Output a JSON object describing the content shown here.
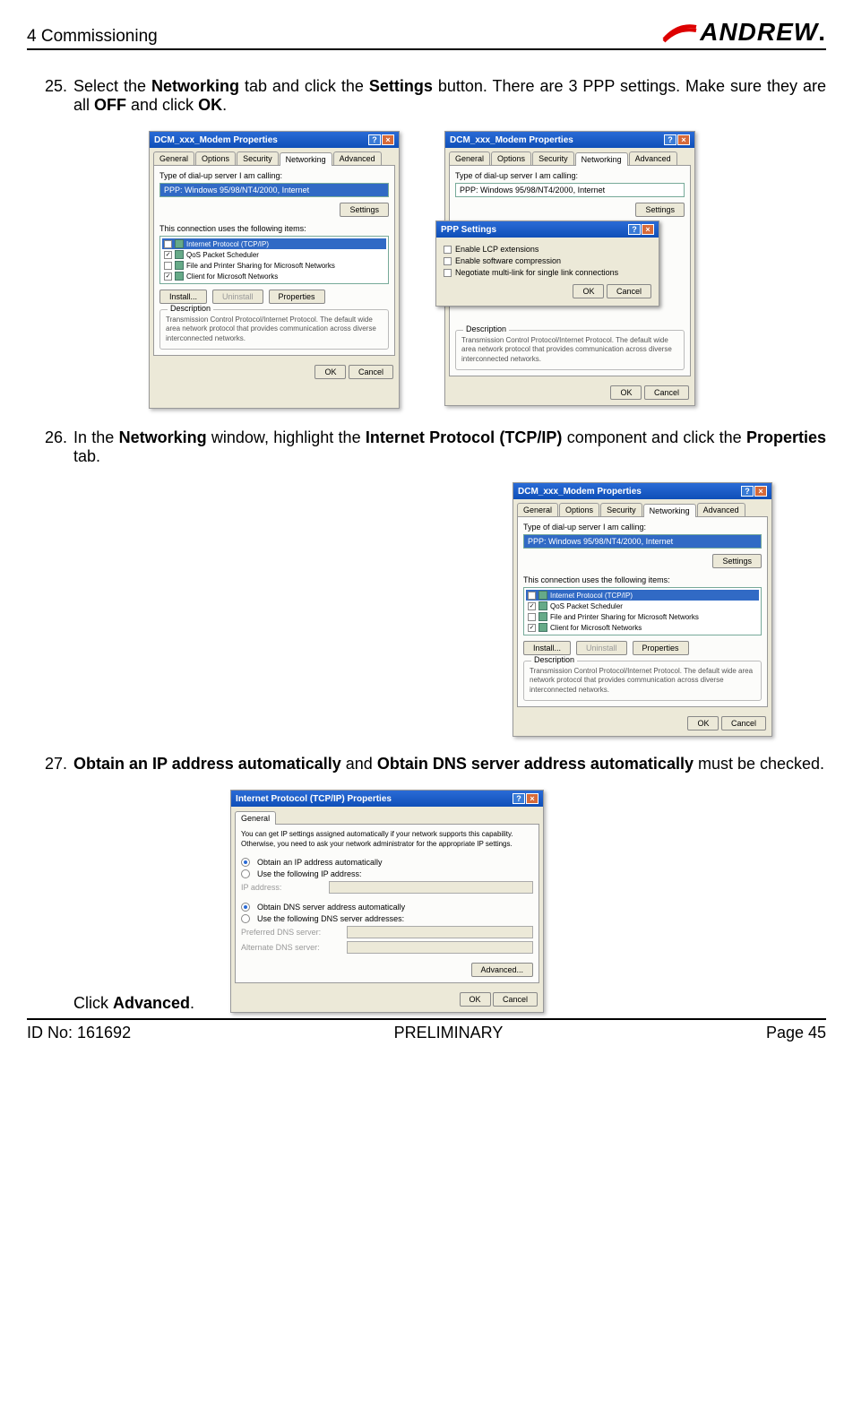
{
  "header": {
    "chapter": "4 Commissioning",
    "brand": "ANDREW"
  },
  "steps": {
    "s25": {
      "num": "25.",
      "t1": "Select the ",
      "b1": "Networking",
      "t2": " tab and click the ",
      "b2": "Settings",
      "t3": " button. There are 3 PPP settings. Make sure they are all ",
      "b3": "OFF",
      "t4": " and click ",
      "b4": "OK",
      "t5": "."
    },
    "s26": {
      "num": "26.",
      "t1": "In the ",
      "b1": "Networking",
      "t2": " window, highlight the ",
      "b2": "Internet Protocol (TCP/IP)",
      "t3": " component and click the ",
      "b3": "Properties",
      "t4": " tab."
    },
    "s27": {
      "num": "27.",
      "b1": "Obtain an IP address automatically",
      "t1": " and ",
      "b2": "Obtain DNS server address automatically",
      "t2": " must be checked.",
      "click": "Click ",
      "adv": "Advanced",
      "dot": "."
    }
  },
  "dlg": {
    "title": "DCM_xxx_Modem Properties",
    "tabs": {
      "general": "General",
      "options": "Options",
      "security": "Security",
      "networking": "Networking",
      "advanced": "Advanced"
    },
    "type_lbl": "Type of dial-up server I am calling:",
    "type_val": "PPP: Windows 95/98/NT4/2000, Internet",
    "settings_btn": "Settings",
    "uses_lbl": "This connection uses the following items:",
    "items": {
      "tcpip": "Internet Protocol (TCP/IP)",
      "qos": "QoS Packet Scheduler",
      "fps": "File and Printer Sharing for Microsoft Networks",
      "client": "Client for Microsoft Networks"
    },
    "install": "Install...",
    "uninstall": "Uninstall",
    "properties": "Properties",
    "desc_title": "Description",
    "desc": "Transmission Control Protocol/Internet Protocol. The default wide area network protocol that provides communication across diverse interconnected networks.",
    "ok": "OK",
    "cancel": "Cancel"
  },
  "ppp": {
    "title": "PPP Settings",
    "opt1": "Enable LCP extensions",
    "opt2": "Enable software compression",
    "opt3": "Negotiate multi-link for single link connections"
  },
  "tcpip": {
    "title": "Internet Protocol (TCP/IP) Properties",
    "tab": "General",
    "intro": "You can get IP settings assigned automatically if your network supports this capability. Otherwise, you need to ask your network administrator for the appropriate IP settings.",
    "r1": "Obtain an IP address automatically",
    "r2": "Use the following IP address:",
    "ip_lbl": "IP address:",
    "r3": "Obtain DNS server address automatically",
    "r4": "Use the following DNS server addresses:",
    "dns1": "Preferred DNS server:",
    "dns2": "Alternate DNS server:",
    "advanced": "Advanced..."
  },
  "footer": {
    "id": "ID No: 161692",
    "status": "PRELIMINARY",
    "page": "Page 45"
  }
}
